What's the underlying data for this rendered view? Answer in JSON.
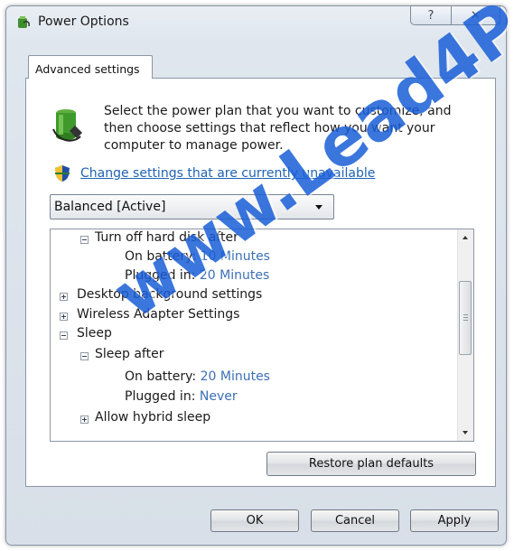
{
  "window": {
    "title": "Power Options",
    "help_glyph": "?",
    "close_glyph": "✕"
  },
  "tab": {
    "label": "Advanced settings"
  },
  "description": "Select the power plan that you want to customize, and then choose settings that reflect how you want your computer to manage power.",
  "link": {
    "label": "Change settings that are currently unavailable"
  },
  "plan_select": {
    "value": "Balanced [Active]"
  },
  "tree": {
    "turn_off_hdd": "Turn off hard disk after",
    "hdd_on_battery_label": "On battery:",
    "hdd_on_battery_value": "10 Minutes",
    "hdd_plugged_label": "Plugged in:",
    "hdd_plugged_value": "20 Minutes",
    "desktop_background": "Desktop background settings",
    "wireless_adapter": "Wireless Adapter Settings",
    "sleep": "Sleep",
    "sleep_after": "Sleep after",
    "sleep_on_battery_label": "On battery:",
    "sleep_on_battery_value": "20 Minutes",
    "sleep_plugged_label": "Plugged in:",
    "sleep_plugged_value": "Never",
    "allow_hybrid_sleep": "Allow hybrid sleep"
  },
  "buttons": {
    "restore": "Restore plan defaults",
    "ok": "OK",
    "cancel": "Cancel",
    "apply": "Apply"
  },
  "watermark": "www.Lead4P",
  "colors": {
    "link": "#1f63b3",
    "value": "#3c6fb5",
    "watermark": "#1a5fd8"
  }
}
